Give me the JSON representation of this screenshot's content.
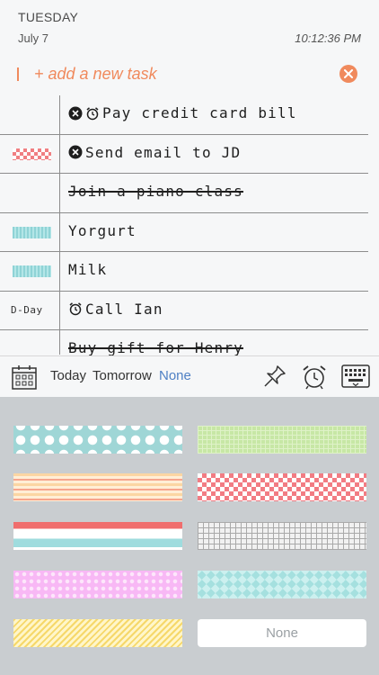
{
  "header": {
    "day": "TUESDAY",
    "date": "July 7",
    "time": "10:12:36 PM"
  },
  "add_task": {
    "placeholder": "+ add a new task"
  },
  "tasks": [
    {
      "tag": "",
      "icons": [
        "no-image-icon",
        "alarm-icon"
      ],
      "label": "Pay credit card bill",
      "done": false
    },
    {
      "tag": "checker-tape",
      "icons": [
        "no-image-icon"
      ],
      "label": "Send email to JD",
      "done": false
    },
    {
      "tag": "",
      "icons": [],
      "label": "Join a piano class",
      "done": true
    },
    {
      "tag": "teal-tape",
      "icons": [],
      "label": "Yorgurt",
      "done": false
    },
    {
      "tag": "teal-tape",
      "icons": [],
      "label": "Milk",
      "done": false
    },
    {
      "tag": "D-Day",
      "icons": [
        "alarm-icon"
      ],
      "label": "Call Ian",
      "done": false
    },
    {
      "tag": "",
      "icons": [],
      "label": "Buy gift for Henry",
      "done": true
    }
  ],
  "toolbar": {
    "chips": [
      {
        "label": "Today",
        "active": false
      },
      {
        "label": "Tomorrow",
        "active": false
      },
      {
        "label": "None",
        "active": true
      }
    ],
    "icons": [
      "calendar-icon",
      "pin-icon",
      "alarm-icon",
      "keyboard-icon"
    ]
  },
  "tape_panel": {
    "none_label": "None",
    "tapes": [
      "teal-dots",
      "green-grid",
      "orange-stripes",
      "red-checker",
      "red-teal-stripes",
      "gray-grid",
      "pink-dots",
      "teal-diamond",
      "yellow-diagonal"
    ]
  },
  "colors": {
    "accent": "#f08a5d",
    "active_chip": "#4f80c4",
    "panel_bg": "#c9cdd0"
  }
}
